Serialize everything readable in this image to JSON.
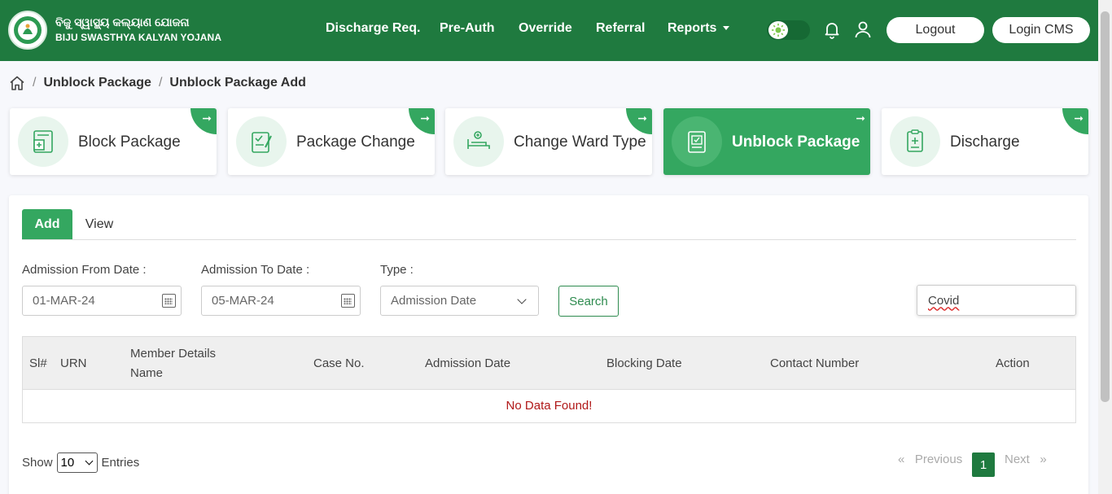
{
  "header": {
    "brand_odia": "ବିଜୁ ସ୍ୱାସ୍ଥ୍ୟ କଲ୍ୟାଣ ଯୋଜନା",
    "brand_en": "BIJU SWASTHYA KALYAN YOJANA",
    "nav": [
      "Discharge Req.",
      "Pre-Auth",
      "Override",
      "Referral",
      "Reports"
    ],
    "logout": "Logout",
    "login_cms": "Login CMS",
    "brand_color": "#1f7a3f"
  },
  "breadcrumb": {
    "icon": "home-icon",
    "items": [
      "Unblock Package",
      "Unblock Package Add"
    ]
  },
  "cards": [
    {
      "label": "Block Package",
      "icon": "block-package-icon",
      "active": false
    },
    {
      "label": "Package Change",
      "icon": "package-change-icon",
      "active": false
    },
    {
      "label": "Change Ward Type",
      "icon": "ward-bed-icon",
      "active": false
    },
    {
      "label": "Unblock Package",
      "icon": "unblock-package-icon",
      "active": true
    },
    {
      "label": "Discharge",
      "icon": "discharge-icon",
      "active": false
    }
  ],
  "tabs": [
    "Add",
    "View"
  ],
  "form": {
    "from_label": "Admission From Date :",
    "from_value": "01-MAR-24",
    "to_label": "Admission To Date :",
    "to_value": "05-MAR-24",
    "type_label": "Type :",
    "type_value": "Admission Date",
    "search": "Search",
    "filter_value": "Covid"
  },
  "table": {
    "headers": [
      "Sl#",
      "URN",
      "Member Details",
      "Name",
      "Case No.",
      "Admission Date",
      "Blocking Date",
      "Contact Number",
      "Action"
    ],
    "empty": "No Data Found!"
  },
  "footer": {
    "show": "Show",
    "page_size": "10",
    "entries": "Entries",
    "prev": "«   Previous",
    "page": "1",
    "next": "Next   »"
  },
  "accent_color": "#34a760",
  "error_color": "#b01818"
}
